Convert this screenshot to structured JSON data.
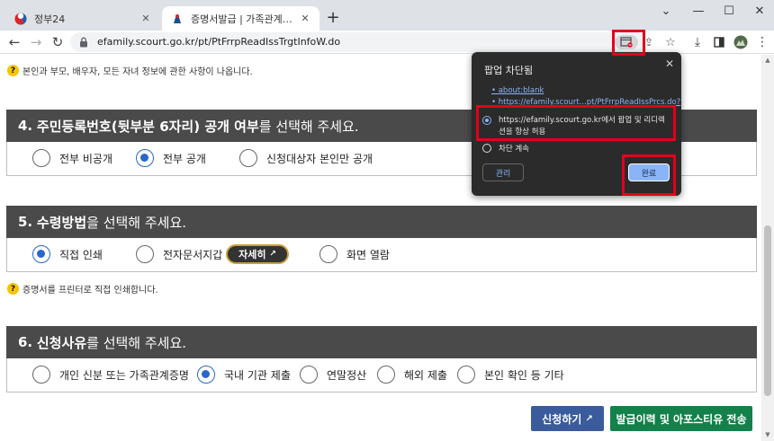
{
  "browser": {
    "tabs": [
      {
        "label": "정부24",
        "active": false
      },
      {
        "label": "증명서발급 | 가족관계등록부 | 대한민국 법원",
        "active": true
      }
    ],
    "new_tab": "+",
    "window_controls": {
      "minimize": "—",
      "maximize": "☐",
      "close": "✕",
      "tab_search": "⌄"
    },
    "url": "efamily.scourt.go.kr/pt/PtFrrpReadIssTrgtInfoW.do"
  },
  "page": {
    "help_top": "본인과 부모, 배우자, 모든 자녀 정보에 관한 사항이 나옵니다.",
    "section4": {
      "num": "4.",
      "bold": "주민등록번호(뒷부분 6자리) 공개 여부",
      "rest": "를 선택해 주세요.",
      "options": [
        "전부 비공개",
        "전부 공개",
        "신청대상자 본인만 공개"
      ],
      "selected": 1
    },
    "section5": {
      "num": "5.",
      "bold": "수령방법",
      "rest": "을 선택해 주세요.",
      "options": [
        "직접 인쇄",
        "전자문서지갑",
        "화면 열람"
      ],
      "selected": 0,
      "detail_button": "자세히"
    },
    "help_mid": "증명서를 프린터로 직접 인쇄합니다.",
    "section6": {
      "num": "6.",
      "bold": "신청사유",
      "rest": "를 선택해 주세요.",
      "options": [
        "개인 신분 또는 가족관계증명",
        "국내 기관 제출",
        "연말정산",
        "해외 제출",
        "본인 확인 등 기타"
      ],
      "selected": 1
    },
    "apply_button": "신청하기",
    "history_button": "발급이력 및 아포스티유 전송"
  },
  "popup_bubble": {
    "title": "팝업 차단됨",
    "links": [
      "about:blank",
      "https://efamily.scourt...pt/PtFrrpReadIssPrcs.do?"
    ],
    "allow_option_line1": "https://efamily.scourt.go.kr에서 팝업 및 리디렉",
    "allow_option_line2": "션을 항상 허용",
    "block_option": "차단 계속",
    "manage_button": "관리",
    "done_button": "완료"
  },
  "colors": {
    "section_header_bg": "#4a4a4a",
    "radio_accent": "#2868c8",
    "apply_button_bg": "#3a5b9c",
    "history_button_bg": "#14804a",
    "highlight_box": "#e3001b",
    "bubble_bg": "#2b2b2b",
    "bubble_accent": "#8ab4f8"
  }
}
